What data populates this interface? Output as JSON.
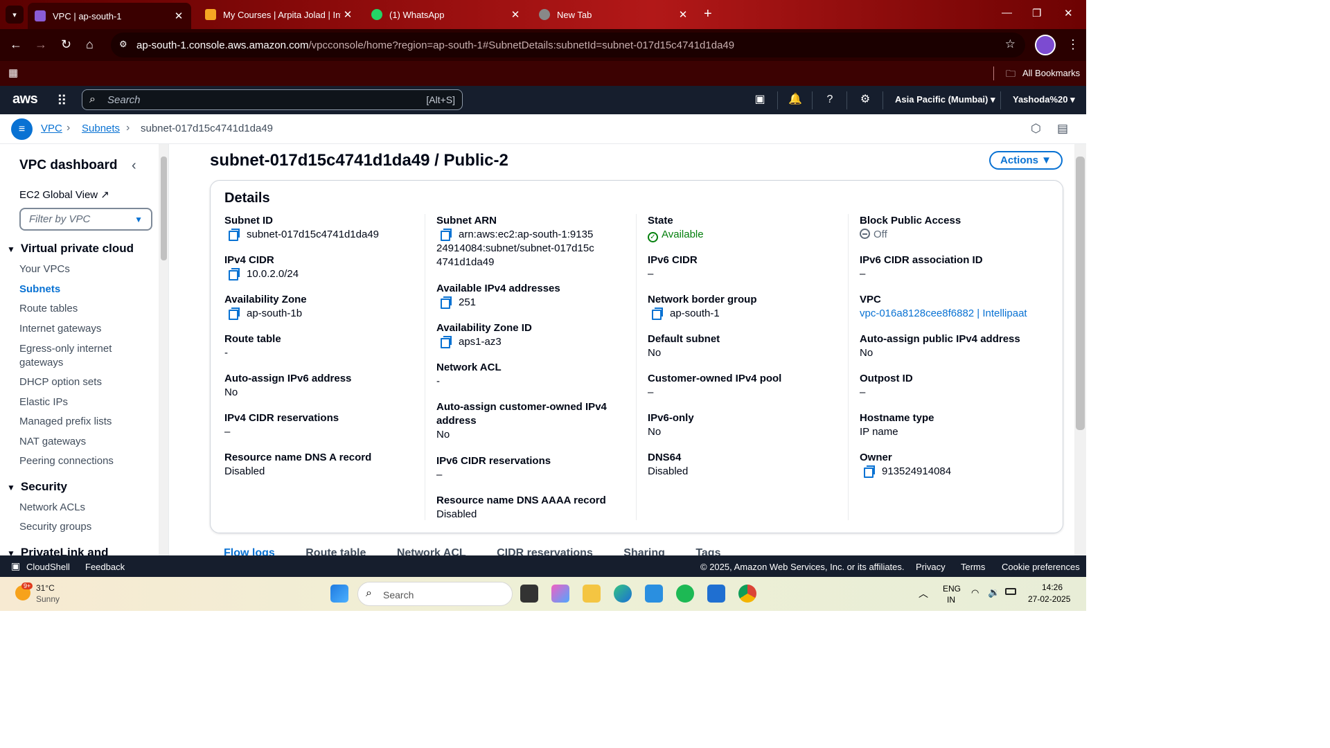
{
  "browser": {
    "tabs": [
      {
        "title": "VPC | ap-south-1",
        "active": true,
        "favicon_color": "#8a5cd6"
      },
      {
        "title": "My Courses | Arpita Jolad | Intel",
        "active": false,
        "favicon_color": "#f5a623"
      },
      {
        "title": "(1) WhatsApp",
        "active": false,
        "favicon_color": "#25d366"
      },
      {
        "title": "New Tab",
        "active": false,
        "favicon_color": "#888888"
      }
    ],
    "url_host": "ap-south-1.console.aws.amazon.com",
    "url_path": "/vpcconsole/home?region=ap-south-1#SubnetDetails:subnetId=subnet-017d15c4741d1da49",
    "bookmarks_label": "All Bookmarks"
  },
  "aws_header": {
    "logo": "aws",
    "search_placeholder": "Search",
    "search_shortcut": "[Alt+S]",
    "region": "Asia Pacific (Mumbai)",
    "account": "Yashoda%20"
  },
  "breadcrumb": {
    "items": [
      "VPC",
      "Subnets",
      "subnet-017d15c4741d1da49"
    ]
  },
  "sidebar": {
    "title": "VPC dashboard",
    "global_view": "EC2 Global View",
    "filter_placeholder": "Filter by VPC",
    "sections": [
      {
        "title": "Virtual private cloud",
        "items": [
          "Your VPCs",
          "Subnets",
          "Route tables",
          "Internet gateways",
          "Egress-only internet gateways",
          "DHCP option sets",
          "Elastic IPs",
          "Managed prefix lists",
          "NAT gateways",
          "Peering connections"
        ]
      },
      {
        "title": "Security",
        "items": [
          "Network ACLs",
          "Security groups"
        ]
      },
      {
        "title": "PrivateLink and"
      }
    ],
    "active_item": "Subnets"
  },
  "page": {
    "title": "subnet-017d15c4741d1da49 / Public-2",
    "actions_label": "Actions",
    "details_heading": "Details"
  },
  "details": {
    "col1": [
      {
        "label": "Subnet ID",
        "value": "subnet-017d15c4741d1da49",
        "copy": true
      },
      {
        "label": "IPv4 CIDR",
        "value": "10.0.2.0/24",
        "copy": true
      },
      {
        "label": "Availability Zone",
        "value": "ap-south-1b",
        "copy": true
      },
      {
        "label": "Route table",
        "value": "-"
      },
      {
        "label": "Auto-assign IPv6 address",
        "value": "No"
      },
      {
        "label": "IPv4 CIDR reservations",
        "value": "–"
      },
      {
        "label": "Resource name DNS A record",
        "value": "Disabled"
      }
    ],
    "col2": [
      {
        "label": "Subnet ARN",
        "value": "arn:aws:ec2:ap-south-1:913524914084:subnet/subnet-017d15c4741d1da49",
        "copy": true
      },
      {
        "label": "Available IPv4 addresses",
        "value": "251",
        "copy": true
      },
      {
        "label": "Availability Zone ID",
        "value": "aps1-az3",
        "copy": true
      },
      {
        "label": "Network ACL",
        "value": "-"
      },
      {
        "label": "Auto-assign customer-owned IPv4 address",
        "value": "No"
      },
      {
        "label": "IPv6 CIDR reservations",
        "value": "–"
      },
      {
        "label": "Resource name DNS AAAA record",
        "value": "Disabled"
      }
    ],
    "col3": [
      {
        "label": "State",
        "value": "Available",
        "status": "ok"
      },
      {
        "label": "IPv6 CIDR",
        "value": "–"
      },
      {
        "label": "Network border group",
        "value": "ap-south-1",
        "copy": true
      },
      {
        "label": "Default subnet",
        "value": "No"
      },
      {
        "label": "Customer-owned IPv4 pool",
        "value": "–"
      },
      {
        "label": "IPv6-only",
        "value": "No"
      },
      {
        "label": "DNS64",
        "value": "Disabled"
      }
    ],
    "col4": [
      {
        "label": "Block Public Access",
        "value": "Off",
        "status": "off"
      },
      {
        "label": "IPv6 CIDR association ID",
        "value": "–"
      },
      {
        "label": "VPC",
        "value": "vpc-016a8128cee8f6882 | Intellipaat",
        "link": true
      },
      {
        "label": "Auto-assign public IPv4 address",
        "value": "No"
      },
      {
        "label": "Outpost ID",
        "value": "–"
      },
      {
        "label": "Hostname type",
        "value": "IP name"
      },
      {
        "label": "Owner",
        "value": "913524914084",
        "copy": true
      }
    ]
  },
  "bottom_tabs": [
    "Flow logs",
    "Route table",
    "Network ACL",
    "CIDR reservations",
    "Sharing",
    "Tags"
  ],
  "footer": {
    "cloudshell": "CloudShell",
    "feedback": "Feedback",
    "copyright": "© 2025, Amazon Web Services, Inc. or its affiliates.",
    "privacy": "Privacy",
    "terms": "Terms",
    "cookies": "Cookie preferences"
  },
  "taskbar": {
    "weather_temp": "31°C",
    "weather_desc": "Sunny",
    "weather_badge": "9+",
    "search_placeholder": "Search",
    "lang_top": "ENG",
    "lang_bottom": "IN",
    "time": "14:26",
    "date": "27-02-2025"
  }
}
